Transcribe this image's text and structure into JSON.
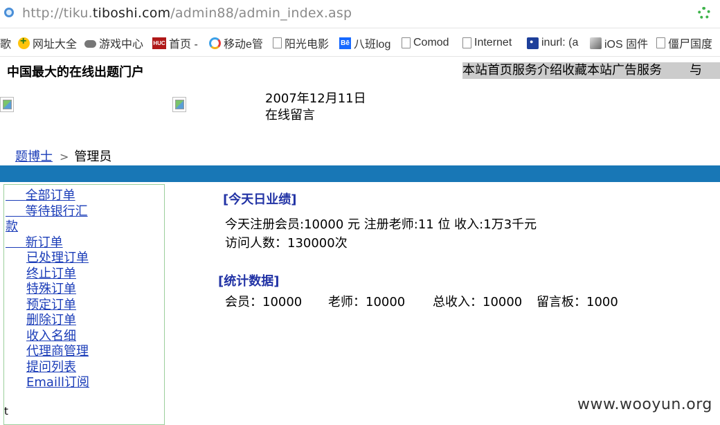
{
  "browser": {
    "url_prefix": "http://tiku.",
    "url_domain": "tiboshi.com",
    "url_path": "/admin88/admin_index.asp",
    "bookmarks": [
      {
        "label": "歌",
        "icon": "none"
      },
      {
        "label": "网址大全",
        "icon": "yellow-plus-icon"
      },
      {
        "label": "游戏中心",
        "icon": "gamepad-icon"
      },
      {
        "label": "首页 -",
        "icon": "huc-icon"
      },
      {
        "label": "移动e管",
        "icon": "q-circle-icon"
      },
      {
        "label": "阳光电影",
        "icon": "page-icon"
      },
      {
        "label": "八班log",
        "icon": "behance-icon"
      },
      {
        "label": "Comod",
        "icon": "page-icon"
      },
      {
        "label": "Internet",
        "icon": "page-icon"
      },
      {
        "label": "inurl: (a",
        "icon": "paw-icon"
      },
      {
        "label": "iOS 固件",
        "icon": "cube-icon"
      },
      {
        "label": "僵尸国度",
        "icon": "page-icon"
      }
    ]
  },
  "header": {
    "site_title": "中国最大的在线出题门户",
    "nav": [
      "本站首页",
      "服务介绍",
      "收藏本站",
      "广告服务",
      "与"
    ],
    "date": "2007年12月11日",
    "message": "在线留言"
  },
  "breadcrumb": {
    "home": "题博士",
    "sep": ">",
    "current": "管理员"
  },
  "sidebar": {
    "items": [
      "全部订单",
      "等待银行汇",
      "款",
      "新订单",
      "已处理订单",
      "终止订单",
      "特殊订单",
      "预定订单",
      "删除订单",
      "收入名细",
      "代理商管理",
      "提问列表",
      "Emaill订阅"
    ],
    "footer": "t"
  },
  "today": {
    "title": "[今天日业绩]",
    "line1": "今天注册会员:10000 元  注册老师:11 位 收入:1万3千元",
    "line2": "访问人数：130000次"
  },
  "stats": {
    "title": "[统计数据]",
    "members": "会员：10000",
    "teachers": "老师：10000",
    "income": "总收入：10000",
    "board": "留言板：1000"
  },
  "watermark": "www.wooyun.org"
}
